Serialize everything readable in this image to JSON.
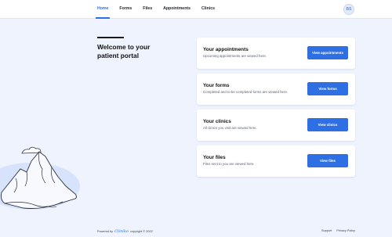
{
  "nav": {
    "items": [
      {
        "label": "Home",
        "active": true
      },
      {
        "label": "Forms",
        "active": false
      },
      {
        "label": "Files",
        "active": false
      },
      {
        "label": "Appointments",
        "active": false
      },
      {
        "label": "Clinics",
        "active": false
      }
    ],
    "avatar_initials": "BS"
  },
  "welcome": {
    "title": "Welcome to your patient portal"
  },
  "cards": [
    {
      "title": "Your appointments",
      "description": "Upcoming appointments are viewed here.",
      "button_label": "View appointments"
    },
    {
      "title": "Your forms",
      "description": "Completed and to be completed forms are viewed here.",
      "button_label": "View forms"
    },
    {
      "title": "Your clinics",
      "description": "All clinics you visit are viewed here.",
      "button_label": "View clinics"
    },
    {
      "title": "Your files",
      "description": "Files sent to you are viewed here.",
      "button_label": "View files"
    }
  ],
  "footer": {
    "powered_by": "Powered by",
    "brand": "Cliniko",
    "copyright": "copyright © 2022",
    "support": "Support",
    "privacy": "Privacy Policy"
  },
  "colors": {
    "accent": "#2f6fe4",
    "background": "#eef3fd",
    "card": "#ffffff"
  },
  "icons": {
    "illustration": "mountain-illustration"
  }
}
